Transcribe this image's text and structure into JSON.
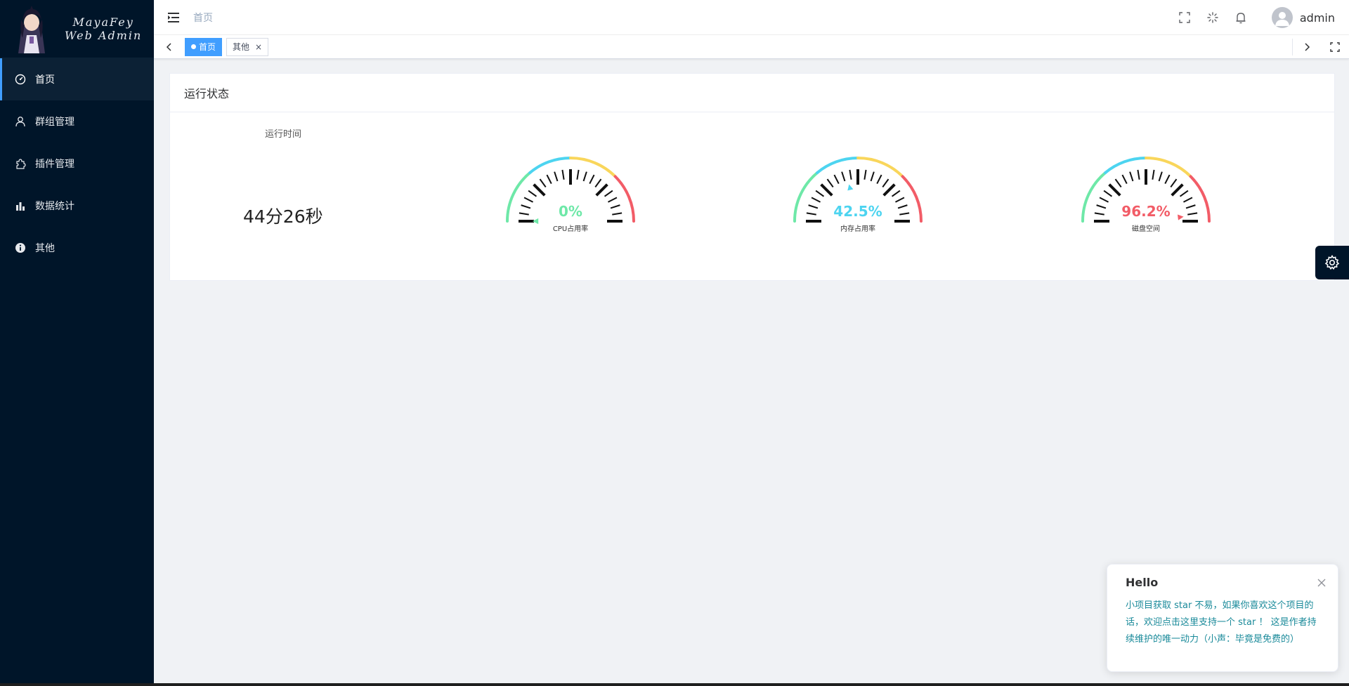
{
  "app": {
    "logo_line1": "MayaFey",
    "logo_line2": "Web Admin"
  },
  "sidebar": {
    "items": [
      {
        "label": "首页",
        "icon": "dashboard-icon",
        "active": true
      },
      {
        "label": "群组管理",
        "icon": "user-icon",
        "active": false
      },
      {
        "label": "插件管理",
        "icon": "puzzle-icon",
        "active": false
      },
      {
        "label": "数据统计",
        "icon": "bar-chart-icon",
        "active": false
      },
      {
        "label": "其他",
        "icon": "info-icon",
        "active": false
      }
    ]
  },
  "header": {
    "breadcrumb": "首页",
    "username": "admin"
  },
  "tags": {
    "items": [
      {
        "label": "首页",
        "active": true
      },
      {
        "label": "其他",
        "active": false,
        "close": "×"
      }
    ]
  },
  "card": {
    "title": "运行状态",
    "runtime_label": "运行时间",
    "runtime_value": "44分26秒"
  },
  "gauges": [
    {
      "value_text": "0%",
      "label": "CPU占用率",
      "value": 0,
      "color": "#6ee8a8"
    },
    {
      "value_text": "42.5%",
      "label": "内存占用率",
      "value": 42.5,
      "color": "#4dd4f0"
    },
    {
      "value_text": "96.2%",
      "label": "磁盘空间",
      "value": 96.2,
      "color": "#f25c67"
    }
  ],
  "gauge_colors": {
    "green": "#6ee8a8",
    "cyan": "#4dd4f0",
    "yellow": "#f9d65b",
    "red": "#f25c67"
  },
  "notification": {
    "title": "Hello",
    "body": "小项目获取 star 不易，如果你喜欢这个项目的话，欢迎点击这里支持一个 star ！ 这是作者持续维护的唯一动力（小声：毕竟是免费的）"
  },
  "colors": {
    "sidebar_bg": "#001529",
    "accent": "#409eff"
  }
}
